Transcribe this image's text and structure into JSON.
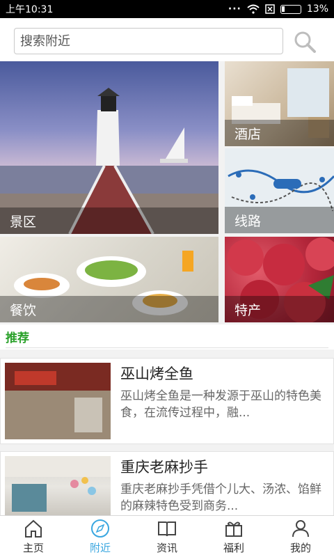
{
  "status_bar": {
    "time": "上午10:31",
    "battery": "13%"
  },
  "search": {
    "placeholder": "搜索附近"
  },
  "tiles": [
    {
      "label": "景区",
      "icon": "lighthouse-photo"
    },
    {
      "label": "酒店",
      "icon": "hotel-room-photo"
    },
    {
      "label": "线路",
      "icon": "route-map-photo"
    },
    {
      "label": "餐饮",
      "icon": "food-table-photo"
    },
    {
      "label": "特产",
      "icon": "bayberry-photo"
    }
  ],
  "recommend": {
    "title": "推荐",
    "items": [
      {
        "title": "巫山烤全鱼",
        "desc": "巫山烤全鱼是一种发源于巫山的特色美食，在流传过程中，融..."
      },
      {
        "title": "重庆老麻抄手",
        "desc": "重庆老麻抄手凭借个儿大、汤浓、馅鲜的麻辣特色受到商务..."
      }
    ]
  },
  "nav": [
    {
      "label": "主页",
      "icon": "home-icon",
      "active": false
    },
    {
      "label": "附近",
      "icon": "compass-icon",
      "active": true
    },
    {
      "label": "资讯",
      "icon": "book-icon",
      "active": false
    },
    {
      "label": "福利",
      "icon": "gift-icon",
      "active": false
    },
    {
      "label": "我的",
      "icon": "user-icon",
      "active": false
    }
  ],
  "colors": {
    "accent_green": "#2aa12a",
    "active_blue": "#3aa7e0"
  }
}
